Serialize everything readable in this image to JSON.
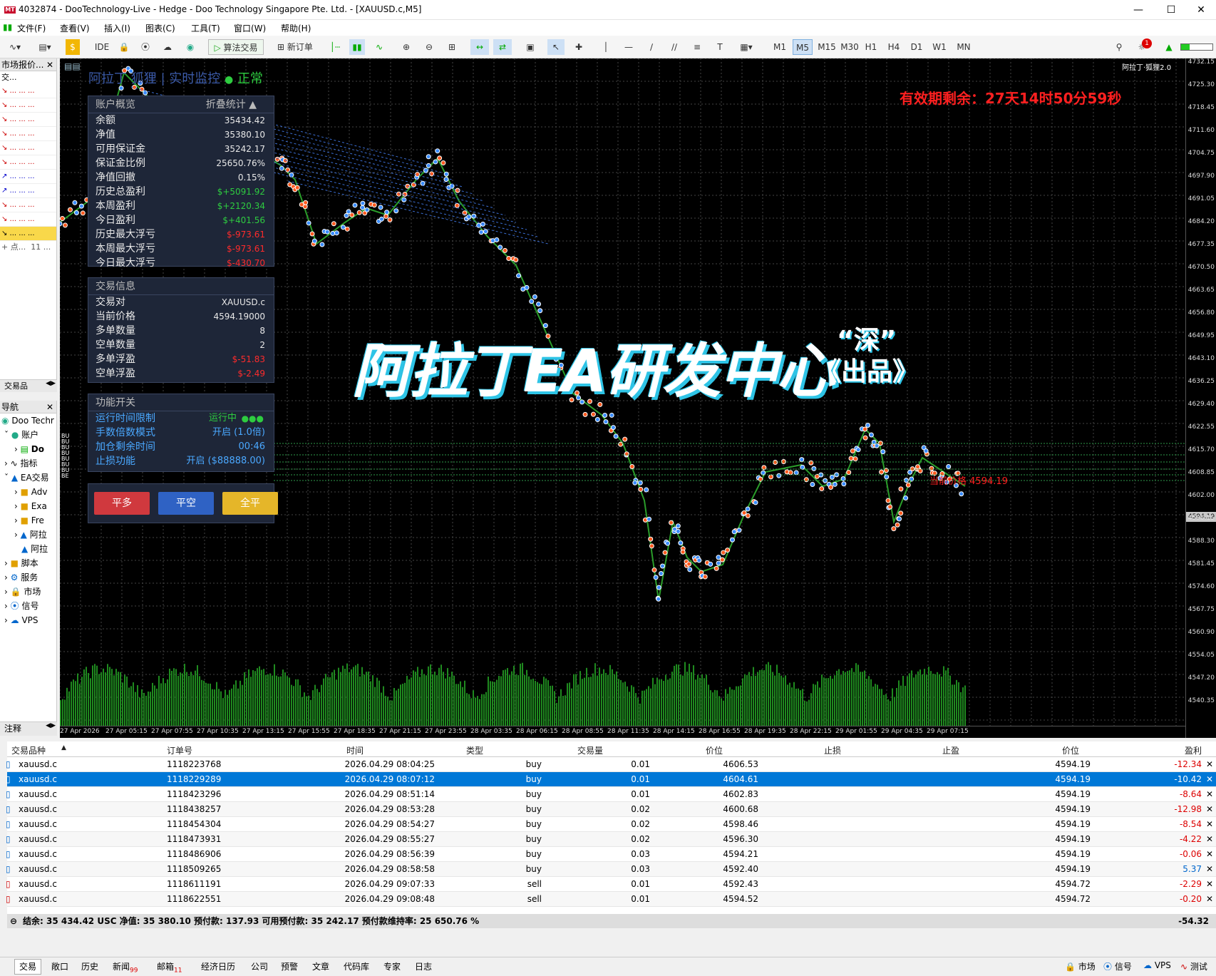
{
  "window": {
    "title": "4032874 - DooTechnology-Live - Hedge - Doo Technology Singapore Pte. Ltd. - [XAUUSD.c,M5]"
  },
  "menu": [
    "文件(F)",
    "查看(V)",
    "插入(I)",
    "图表(C)",
    "工具(T)",
    "窗口(W)",
    "帮助(H)"
  ],
  "toolbar": {
    "ide": "IDE",
    "algo": "算法交易",
    "new_order": "新订单",
    "timeframes": [
      "M1",
      "M5",
      "M15",
      "M30",
      "H1",
      "H4",
      "D1",
      "W1",
      "MN"
    ],
    "active_tf": "M5",
    "notif_count": "1"
  },
  "market_watch": {
    "title": "市场报价...",
    "col": "交...",
    "footer_left": "+ 点...",
    "footer_right": "11 ...",
    "tab": "交易品"
  },
  "navigator": {
    "title": "导航",
    "items": [
      "Doo Techr",
      "账户",
      "Do",
      "指标",
      "EA交易",
      "Adv",
      "Exa",
      "Fre",
      "阿拉",
      "阿拉",
      "脚本",
      "服务",
      "市场",
      "信号",
      "VPS"
    ],
    "tab": "注释"
  },
  "chart": {
    "header_text": "阿拉丁 狐狸 | 实时监控",
    "status": "正常",
    "expiry": "有效期剩余：27天14时50分59秒",
    "watermark": "阿拉丁EA研发中心",
    "watermark_quote": "“深”",
    "watermark_sub": "《出品》",
    "corner_label": "阿拉丁·狐狸2.0",
    "current_label": "当前价格",
    "current_value": "4594.19",
    "price_tag": "4594.19",
    "left_axis_tags": [
      "BU",
      "BU",
      "BU",
      "BU",
      "BU",
      "BU",
      "BU",
      "BE"
    ],
    "price_ticks": [
      "4732.15",
      "4725.30",
      "4718.45",
      "4711.60",
      "4704.75",
      "4697.90",
      "4691.05",
      "4684.20",
      "4677.35",
      "4670.50",
      "4663.65",
      "4656.80",
      "4649.95",
      "4643.10",
      "4636.25",
      "4629.40",
      "4622.55",
      "4615.70",
      "4608.85",
      "4602.00",
      "4595.15",
      "4588.30",
      "4581.45",
      "4574.60",
      "4567.75",
      "4560.90",
      "4554.05",
      "4547.20",
      "4540.35"
    ],
    "time_ticks": [
      "27 Apr 2026",
      "27 Apr 05:15",
      "27 Apr 07:55",
      "27 Apr 10:35",
      "27 Apr 13:15",
      "27 Apr 15:55",
      "27 Apr 18:35",
      "27 Apr 21:15",
      "27 Apr 23:55",
      "28 Apr 03:35",
      "28 Apr 06:15",
      "28 Apr 08:55",
      "28 Apr 11:35",
      "28 Apr 14:15",
      "28 Apr 16:55",
      "28 Apr 19:35",
      "28 Apr 22:15",
      "29 Apr 01:55",
      "29 Apr 04:35",
      "29 Apr 07:15"
    ]
  },
  "account_panel": {
    "title": "账户概览",
    "fold": "折叠统计 ▲",
    "rows": [
      {
        "label": "余额",
        "value": "35434.42",
        "cls": ""
      },
      {
        "label": "净值",
        "value": "35380.10",
        "cls": ""
      },
      {
        "label": "可用保证金",
        "value": "35242.17",
        "cls": ""
      },
      {
        "label": "保证金比例",
        "value": "25650.76%",
        "cls": ""
      },
      {
        "label": "净值回撤",
        "value": "0.15%",
        "cls": ""
      },
      {
        "label": "历史总盈利",
        "value": "$+5091.92",
        "cls": "pos"
      },
      {
        "label": "本周盈利",
        "value": "$+2120.34",
        "cls": "pos"
      },
      {
        "label": "今日盈利",
        "value": "$+401.56",
        "cls": "pos"
      },
      {
        "label": "历史最大浮亏",
        "value": "$-973.61",
        "cls": "neg"
      },
      {
        "label": "本周最大浮亏",
        "value": "$-973.61",
        "cls": "neg"
      },
      {
        "label": "今日最大浮亏",
        "value": "$-430.70",
        "cls": "neg"
      }
    ]
  },
  "trade_panel": {
    "title": "交易信息",
    "rows": [
      {
        "label": "交易对",
        "value": "XAUUSD.c",
        "cls": ""
      },
      {
        "label": "当前价格",
        "value": "4594.19000",
        "cls": ""
      },
      {
        "label": "多单数量",
        "value": "8",
        "cls": ""
      },
      {
        "label": "空单数量",
        "value": "2",
        "cls": ""
      },
      {
        "label": "多单浮盈",
        "value": "$-51.83",
        "cls": "neg"
      },
      {
        "label": "空单浮盈",
        "value": "$-2.49",
        "cls": "neg"
      }
    ]
  },
  "func_panel": {
    "title": "功能开关",
    "rows": [
      {
        "label": "运行时间限制",
        "value": "运行中"
      },
      {
        "label": "手数倍数模式",
        "value": "开启 (1.0倍)"
      },
      {
        "label": "加仓剩余时间",
        "value": "00:46"
      },
      {
        "label": "止损功能",
        "value": "开启 ($88888.00)"
      }
    ]
  },
  "buttons": {
    "close_long": "平多",
    "close_short": "平空",
    "close_all": "全平"
  },
  "trade_table": {
    "headers": [
      "交易品种",
      "订单号",
      "时间",
      "类型",
      "交易量",
      "价位",
      "止损",
      "止盈",
      "价位",
      "盈利"
    ],
    "rows": [
      [
        "xauusd.c",
        "1118223768",
        "2026.04.29 08:04:25",
        "buy",
        "0.01",
        "4606.53",
        "",
        "",
        "4594.19",
        "-12.34"
      ],
      [
        "xauusd.c",
        "1118229289",
        "2026.04.29 08:07:12",
        "buy",
        "0.01",
        "4604.61",
        "",
        "",
        "4594.19",
        "-10.42"
      ],
      [
        "xauusd.c",
        "1118423296",
        "2026.04.29 08:51:14",
        "buy",
        "0.01",
        "4602.83",
        "",
        "",
        "4594.19",
        "-8.64"
      ],
      [
        "xauusd.c",
        "1118438257",
        "2026.04.29 08:53:28",
        "buy",
        "0.02",
        "4600.68",
        "",
        "",
        "4594.19",
        "-12.98"
      ],
      [
        "xauusd.c",
        "1118454304",
        "2026.04.29 08:54:27",
        "buy",
        "0.02",
        "4598.46",
        "",
        "",
        "4594.19",
        "-8.54"
      ],
      [
        "xauusd.c",
        "1118473931",
        "2026.04.29 08:55:27",
        "buy",
        "0.02",
        "4596.30",
        "",
        "",
        "4594.19",
        "-4.22"
      ],
      [
        "xauusd.c",
        "1118486906",
        "2026.04.29 08:56:39",
        "buy",
        "0.03",
        "4594.21",
        "",
        "",
        "4594.19",
        "-0.06"
      ],
      [
        "xauusd.c",
        "1118509265",
        "2026.04.29 08:58:58",
        "buy",
        "0.03",
        "4592.40",
        "",
        "",
        "4594.19",
        "5.37"
      ],
      [
        "xauusd.c",
        "1118611191",
        "2026.04.29 09:07:33",
        "sell",
        "0.01",
        "4592.43",
        "",
        "",
        "4594.72",
        "-2.29"
      ],
      [
        "xauusd.c",
        "1118622551",
        "2026.04.29 09:08:48",
        "sell",
        "0.01",
        "4594.52",
        "",
        "",
        "4594.72",
        "-0.20"
      ]
    ],
    "summary": "结余: 35 434.42 USC  净值: 35 380.10  预付款: 137.93  可用预付款: 35 242.17  预付款维持率: 25 650.76 %",
    "summary_total": "-54.32"
  },
  "bottom_tabs": [
    "交易",
    "敞口",
    "历史",
    "新闻",
    "邮箱",
    "经济日历",
    "公司",
    "预警",
    "文章",
    "代码库",
    "专家",
    "日志"
  ],
  "badges": {
    "news": "99",
    "mail": "11"
  },
  "status": [
    "市场",
    "信号",
    "VPS",
    "测试"
  ]
}
